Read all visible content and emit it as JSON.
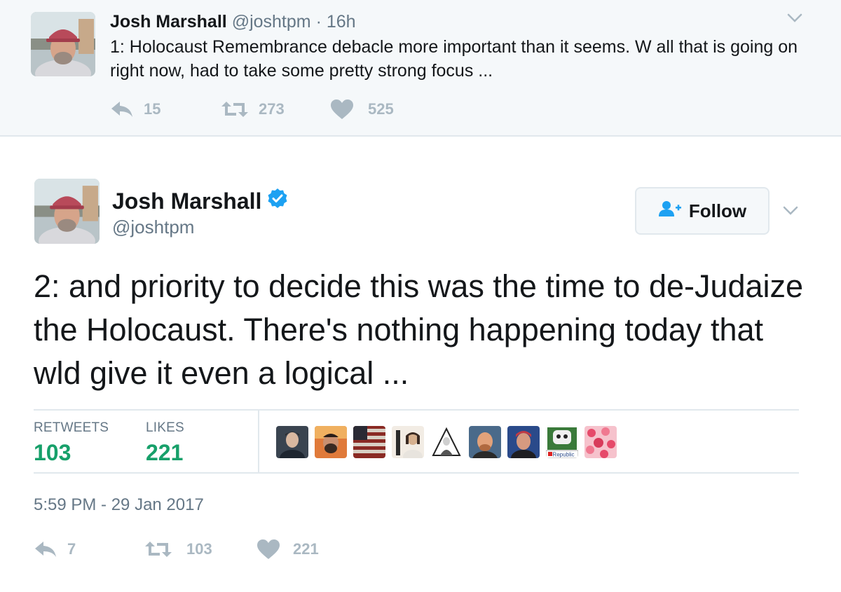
{
  "parent_tweet": {
    "name": "Josh Marshall",
    "handle": "@joshtpm",
    "separator": "·",
    "time": "16h",
    "text": "1: Holocaust Remembrance debacle more important than it seems. W all that is going on right now, had to take some pretty strong focus ...",
    "reply_count": "15",
    "retweet_count": "273",
    "like_count": "525"
  },
  "main_tweet": {
    "name": "Josh Marshall",
    "handle": "@joshtpm",
    "follow_label": "Follow",
    "text": "2: and priority to decide this was the time to de-Judaize the Holocaust. There's nothing happening today that wld give it even a logical ...",
    "retweets_label": "RETWEETS",
    "retweets_value": "103",
    "likes_label": "LIKES",
    "likes_value": "221",
    "timestamp": "5:59 PM - 29 Jan 2017",
    "reply_count": "7",
    "retweet_count": "103",
    "like_count": "221",
    "liker_badge_text": "Republic"
  },
  "colors": {
    "accent": "#1da1f2",
    "stat_value": "#17a06a",
    "muted": "#657786",
    "action_icon": "#aab8c2",
    "parent_bg": "#f5f8fa"
  },
  "icons": [
    "reply-icon",
    "retweet-icon",
    "heart-icon",
    "verified-badge-icon",
    "follow-user-icon",
    "chevron-down-icon"
  ]
}
